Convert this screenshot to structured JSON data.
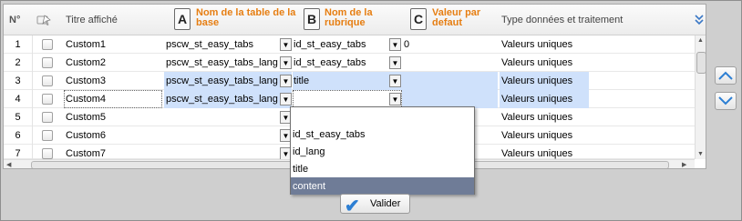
{
  "header": {
    "num": "N°",
    "title": "Titre affiché",
    "letter_a": "A",
    "table": "Nom de la table de la base",
    "letter_b": "B",
    "rubrique": "Nom de la rubrique",
    "letter_c": "C",
    "default": "Valeur par defaut",
    "type": "Type données et traitement",
    "expand_icon": "double-chevron-down-icon"
  },
  "rows": [
    {
      "num": "1",
      "title": "Custom1",
      "table": "pscw_st_easy_tabs",
      "rubrique": "id_st_easy_tabs",
      "default": "0",
      "type": "Valeurs uniques"
    },
    {
      "num": "2",
      "title": "Custom2",
      "table": "pscw_st_easy_tabs_lang",
      "rubrique": "id_st_easy_tabs",
      "default": "",
      "type": "Valeurs uniques"
    },
    {
      "num": "3",
      "title": "Custom3",
      "table": "pscw_st_easy_tabs_lang",
      "rubrique": "title",
      "default": "",
      "type": "Valeurs uniques"
    },
    {
      "num": "4",
      "title": "Custom4",
      "table": "pscw_st_easy_tabs_lang",
      "rubrique": "",
      "default": "",
      "type": "Valeurs uniques"
    },
    {
      "num": "5",
      "title": "Custom5",
      "table": "",
      "rubrique": "",
      "default": "",
      "type": "Valeurs uniques"
    },
    {
      "num": "6",
      "title": "Custom6",
      "table": "",
      "rubrique": "",
      "default": "",
      "type": "Valeurs uniques"
    },
    {
      "num": "7",
      "title": "Custom7",
      "table": "",
      "rubrique": "",
      "default": "",
      "type": "Valeurs uniques"
    }
  ],
  "dropdown": {
    "options": [
      "",
      "id_st_easy_tabs",
      "id_lang",
      "title",
      "content"
    ],
    "selected_index": 4
  },
  "buttons": {
    "valider": "Valider",
    "up_icon": "chevron-up-icon",
    "down_icon": "chevron-down-icon"
  },
  "colors": {
    "accent_orange": "#e67e12",
    "highlight_row": "#cfe1fb",
    "selected_option": "#6f7c97",
    "arrow_blue": "#2d7fd3"
  }
}
